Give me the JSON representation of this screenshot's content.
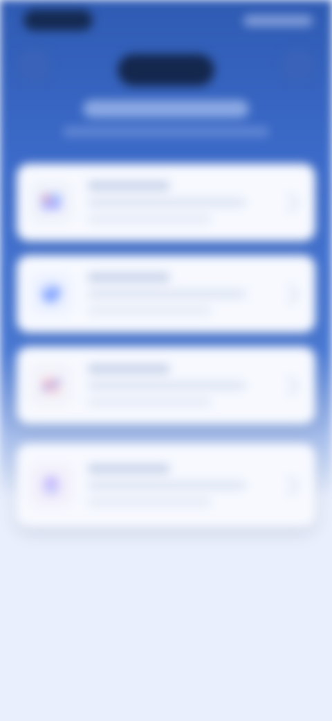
{
  "header": {
    "brand": "",
    "title": "",
    "subtitle": ""
  },
  "cards": [
    {
      "title": "",
      "subtitle": ""
    },
    {
      "title": "",
      "subtitle": ""
    },
    {
      "title": "",
      "subtitle": ""
    },
    {
      "title": "",
      "subtitle": ""
    }
  ],
  "colors": {
    "hero_top": "#2f5bb3",
    "hero_mid": "#4a79d3",
    "page_bg": "#e9effc",
    "card_bg": "#f7f9ff"
  }
}
